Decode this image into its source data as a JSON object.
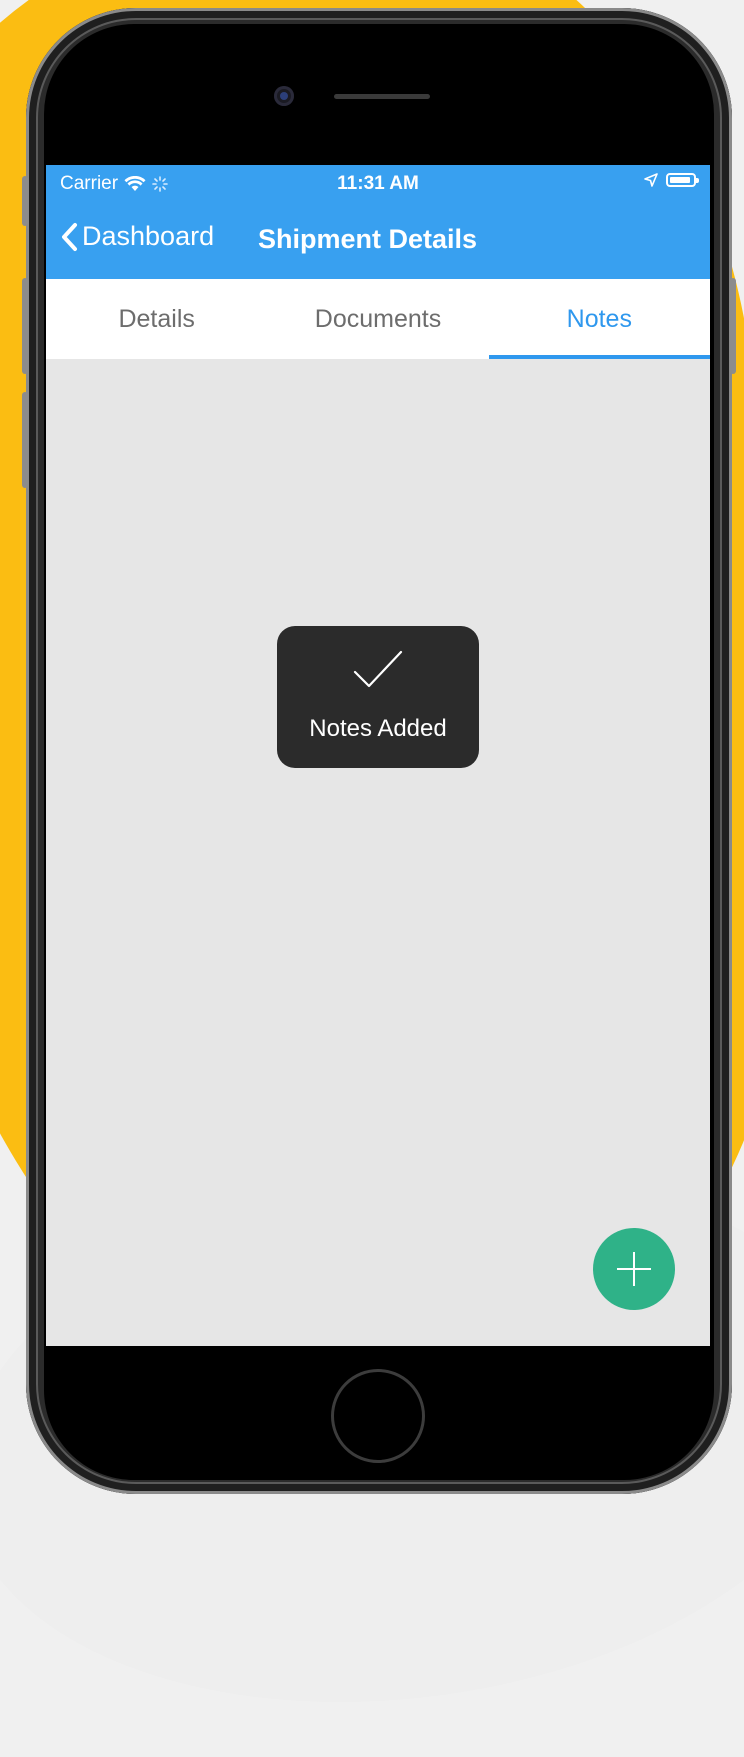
{
  "status_bar": {
    "carrier": "Carrier",
    "time": "11:31 AM"
  },
  "nav_bar": {
    "back_label": "Dashboard",
    "title": "Shipment Details"
  },
  "tabs": [
    {
      "label": "Details",
      "active": false
    },
    {
      "label": "Documents",
      "active": false
    },
    {
      "label": "Notes",
      "active": true
    }
  ],
  "toast": {
    "message": "Notes Added",
    "icon": "checkmark-icon"
  },
  "fab": {
    "icon": "plus-icon"
  },
  "colors": {
    "accent": "#38a0f0",
    "tab_active": "#2f98ee",
    "fab": "#2fb288",
    "background_blob": "#fbbd12",
    "content_bg": "#e6e6e6"
  }
}
